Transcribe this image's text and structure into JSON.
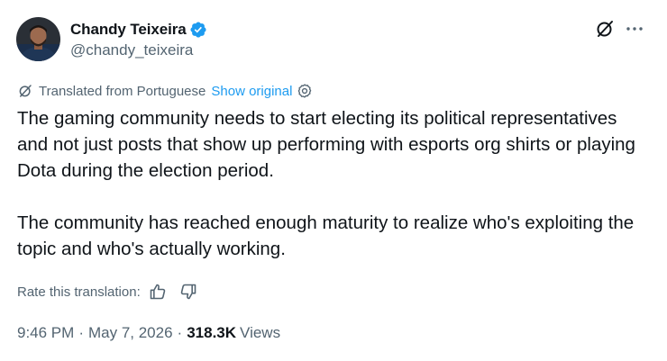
{
  "author": {
    "display_name": "Chandy Teixeira",
    "handle": "@chandy_teixeira",
    "verified": true,
    "verified_color": "#1d9bf0"
  },
  "translation": {
    "notice": "Translated from Portuguese",
    "show_original": "Show original"
  },
  "tweet": {
    "paragraphs": [
      "The gaming community needs to start electing its political representatives and not just posts that show up performing with esports org shirts or playing Dota during the election period.",
      "The community has reached enough maturity to realize who's exploiting the topic and who's actually working."
    ]
  },
  "rating": {
    "label": "Rate this translation:"
  },
  "meta": {
    "time": "9:46 PM",
    "separator": "·",
    "date": "May 7, 2026",
    "views_count": "318.3K",
    "views_label": "Views"
  },
  "icons": {
    "grok": "grok-icon",
    "more": "more-icon",
    "translate": "translate-icon",
    "settings": "settings-icon",
    "thumbs_up": "thumbs-up-icon",
    "thumbs_down": "thumbs-down-icon"
  },
  "colors": {
    "text_primary": "#0f1419",
    "text_secondary": "#536471",
    "link": "#1d9bf0"
  }
}
